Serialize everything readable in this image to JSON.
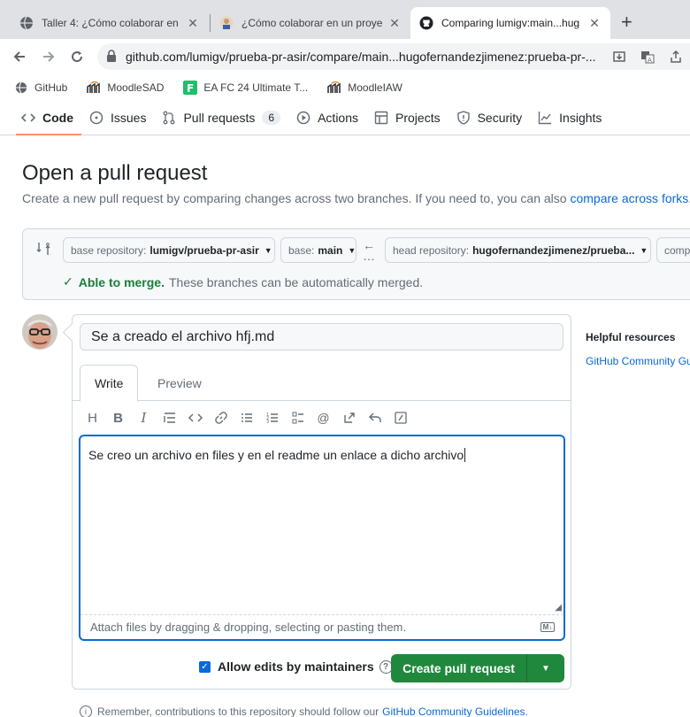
{
  "browser": {
    "tabs": [
      {
        "title": "Taller 4: ¿Cómo colaborar en u",
        "active": false
      },
      {
        "title": "¿Cómo colaborar en un proye",
        "active": false
      },
      {
        "title": "Comparing lumigv:main...hug",
        "active": true
      }
    ],
    "url": "github.com/lumigv/prueba-pr-asir/compare/main...hugofernandezjimenez:prueba-pr-...",
    "bookmarks": [
      "GitHub",
      "MoodleSAD",
      "EA FC 24 Ultimate T...",
      "MoodleIAW"
    ]
  },
  "repo_nav": {
    "items": [
      {
        "label": "Code",
        "icon": "code-icon"
      },
      {
        "label": "Issues",
        "icon": "issue-icon"
      },
      {
        "label": "Pull requests",
        "icon": "pull-request-icon",
        "count": "6"
      },
      {
        "label": "Actions",
        "icon": "play-icon"
      },
      {
        "label": "Projects",
        "icon": "table-icon"
      },
      {
        "label": "Security",
        "icon": "shield-icon"
      },
      {
        "label": "Insights",
        "icon": "graph-icon"
      }
    ]
  },
  "header": {
    "title": "Open a pull request",
    "subtitle": "Create a new pull request by comparing changes across two branches. If you need to, you can also",
    "subtitle_link": "compare across forks",
    "subtitle_end": "."
  },
  "compare": {
    "base_repo_label": "base repository:",
    "base_repo_value": "lumigv/prueba-pr-asir",
    "base_label": "base:",
    "base_value": "main",
    "head_repo_label": "head repository:",
    "head_repo_value": "hugofernandezjimenez/prueba...",
    "compare_label": "comp",
    "merge_ok": "Able to merge.",
    "merge_text": "These branches can be automatically merged."
  },
  "form": {
    "title_value": "Se a creado el archivo hfj.md",
    "tab_write": "Write",
    "tab_preview": "Preview",
    "body_value": "Se creo un archivo en files y en el readme un enlace a dicho archivo",
    "attach_text": "Attach files by dragging & dropping, selecting or pasting them.",
    "markdown_badge": "M↓",
    "allow_edits": "Allow edits by maintainers",
    "submit_label": "Create pull request"
  },
  "sidebar": {
    "heading": "Helpful resources",
    "link": "GitHub Community Gu"
  },
  "footer": {
    "reminder": "Remember, contributions to this repository should follow our",
    "reminder_link": "GitHub Community Guidelines."
  }
}
